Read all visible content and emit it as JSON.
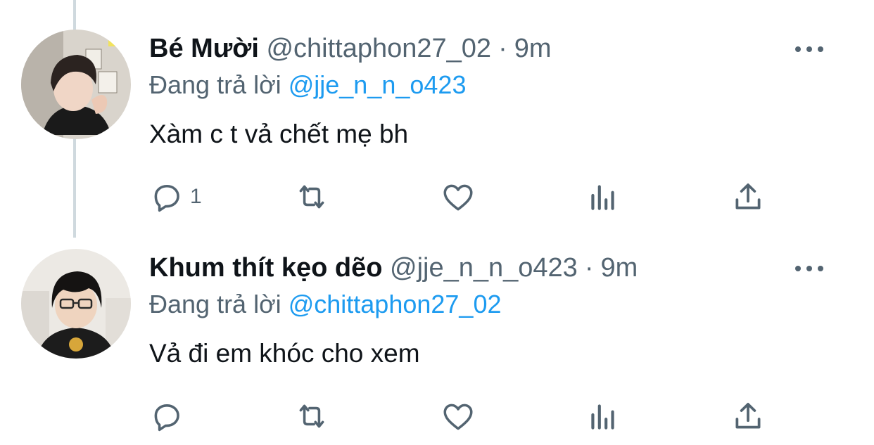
{
  "tweets": [
    {
      "display_name": "Bé Mười",
      "handle": "@chittaphon27_02",
      "separator": "·",
      "time": "9m",
      "replying_prefix": "Đang trả lời",
      "replying_to": "@jje_n_n_o423",
      "text": "Xàm c t vả chết mẹ bh",
      "reply_count": "1",
      "icons": [
        "more-icon",
        "reply-icon",
        "retweet-icon",
        "like-icon",
        "stats-icon",
        "share-icon"
      ]
    },
    {
      "display_name": "Khum thít kẹo dẽo",
      "handle": "@jje_n_n_o423",
      "separator": "·",
      "time": "9m",
      "replying_prefix": "Đang trả lời",
      "replying_to": "@chittaphon27_02",
      "text": "Vả đi em khóc cho xem",
      "reply_count": "",
      "icons": [
        "more-icon",
        "reply-icon",
        "retweet-icon",
        "like-icon",
        "stats-icon",
        "share-icon"
      ]
    }
  ],
  "colors": {
    "text": "#0f1419",
    "secondary": "#536471",
    "link": "#1d9bf0",
    "thread_line": "#cfd9de"
  }
}
